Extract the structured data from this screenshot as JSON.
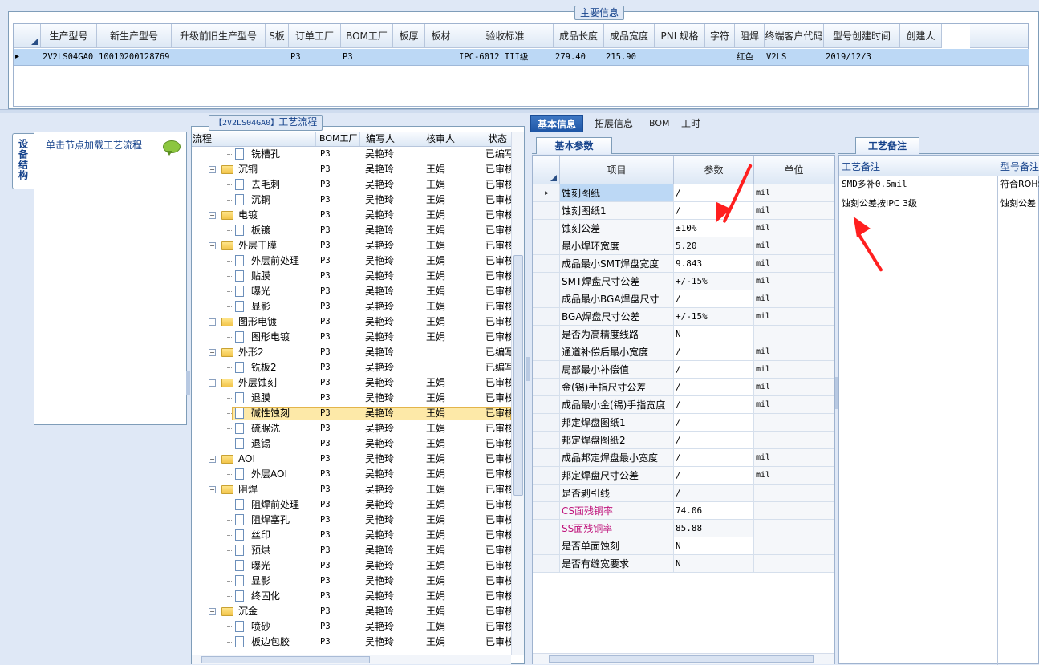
{
  "top_group": {
    "legend": "主要信息"
  },
  "main_grid": {
    "headers": [
      "生产型号",
      "新生产型号",
      "升级前旧生产型号",
      "S板",
      "订单工厂",
      "BOM工厂",
      "板厚",
      "板材",
      "验收标准",
      "成品长度",
      "成品宽度",
      "PNL规格",
      "字符",
      "阻焊",
      "终端客户代码",
      "型号创建时间",
      "创建人"
    ],
    "row": {
      "marker": "▸",
      "values": [
        "2V2LS04GA0",
        "10010200128769",
        "",
        "",
        "P3",
        "P3",
        "",
        "",
        "IPC-6012 III级",
        "279.40",
        "215.90",
        "",
        "",
        "红色",
        "V2LS",
        "2019/12/3",
        ""
      ]
    }
  },
  "left_panel": {
    "vertical_tab": "设备结构",
    "hint": "单击节点加载工艺流程"
  },
  "flow_panel": {
    "legend_prefix": "【2V2LS04GA0】",
    "legend_suffix": "工艺流程",
    "headers": [
      "流程",
      "BOM工厂",
      "编写人",
      "核审人",
      "状态"
    ],
    "rows": [
      {
        "type": "doc",
        "level": 2,
        "name": "铣槽孔",
        "bom": "P3",
        "writer": "吴艳玲",
        "reviewer": "",
        "status": "已编写"
      },
      {
        "type": "folder",
        "level": 1,
        "name": "沉铜",
        "bom": "P3",
        "writer": "吴艳玲",
        "reviewer": "王娟",
        "status": "已审核"
      },
      {
        "type": "doc",
        "level": 2,
        "name": "去毛刺",
        "bom": "P3",
        "writer": "吴艳玲",
        "reviewer": "王娟",
        "status": "已审核"
      },
      {
        "type": "doc",
        "level": 2,
        "name": "沉铜",
        "bom": "P3",
        "writer": "吴艳玲",
        "reviewer": "王娟",
        "status": "已审核"
      },
      {
        "type": "folder",
        "level": 1,
        "name": "电镀",
        "bom": "P3",
        "writer": "吴艳玲",
        "reviewer": "王娟",
        "status": "已审核"
      },
      {
        "type": "doc",
        "level": 2,
        "name": "板镀",
        "bom": "P3",
        "writer": "吴艳玲",
        "reviewer": "王娟",
        "status": "已审核"
      },
      {
        "type": "folder",
        "level": 1,
        "name": "外层干膜",
        "bom": "P3",
        "writer": "吴艳玲",
        "reviewer": "王娟",
        "status": "已审核"
      },
      {
        "type": "doc",
        "level": 2,
        "name": "外层前处理",
        "bom": "P3",
        "writer": "吴艳玲",
        "reviewer": "王娟",
        "status": "已审核"
      },
      {
        "type": "doc",
        "level": 2,
        "name": "贴膜",
        "bom": "P3",
        "writer": "吴艳玲",
        "reviewer": "王娟",
        "status": "已审核"
      },
      {
        "type": "doc",
        "level": 2,
        "name": "曝光",
        "bom": "P3",
        "writer": "吴艳玲",
        "reviewer": "王娟",
        "status": "已审核"
      },
      {
        "type": "doc",
        "level": 2,
        "name": "显影",
        "bom": "P3",
        "writer": "吴艳玲",
        "reviewer": "王娟",
        "status": "已审核"
      },
      {
        "type": "folder",
        "level": 1,
        "name": "图形电镀",
        "bom": "P3",
        "writer": "吴艳玲",
        "reviewer": "王娟",
        "status": "已审核"
      },
      {
        "type": "doc",
        "level": 2,
        "name": "图形电镀",
        "bom": "P3",
        "writer": "吴艳玲",
        "reviewer": "王娟",
        "status": "已审核"
      },
      {
        "type": "folder",
        "level": 1,
        "name": "外形2",
        "bom": "P3",
        "writer": "吴艳玲",
        "reviewer": "",
        "status": "已编写"
      },
      {
        "type": "doc",
        "level": 2,
        "name": "铣板2",
        "bom": "P3",
        "writer": "吴艳玲",
        "reviewer": "",
        "status": "已编写"
      },
      {
        "type": "folder",
        "level": 1,
        "name": "外层蚀刻",
        "bom": "P3",
        "writer": "吴艳玲",
        "reviewer": "王娟",
        "status": "已审核"
      },
      {
        "type": "doc",
        "level": 2,
        "name": "退膜",
        "bom": "P3",
        "writer": "吴艳玲",
        "reviewer": "王娟",
        "status": "已审核"
      },
      {
        "type": "doc",
        "level": 2,
        "name": "碱性蚀刻",
        "bom": "P3",
        "writer": "吴艳玲",
        "reviewer": "王娟",
        "status": "已审核",
        "selected": true
      },
      {
        "type": "doc",
        "level": 2,
        "name": "硫脲洗",
        "bom": "P3",
        "writer": "吴艳玲",
        "reviewer": "王娟",
        "status": "已审核"
      },
      {
        "type": "doc",
        "level": 2,
        "name": "退锡",
        "bom": "P3",
        "writer": "吴艳玲",
        "reviewer": "王娟",
        "status": "已审核"
      },
      {
        "type": "folder",
        "level": 1,
        "name": "AOI",
        "bom": "P3",
        "writer": "吴艳玲",
        "reviewer": "王娟",
        "status": "已审核"
      },
      {
        "type": "doc",
        "level": 2,
        "name": "外层AOI",
        "bom": "P3",
        "writer": "吴艳玲",
        "reviewer": "王娟",
        "status": "已审核"
      },
      {
        "type": "folder",
        "level": 1,
        "name": "阻焊",
        "bom": "P3",
        "writer": "吴艳玲",
        "reviewer": "王娟",
        "status": "已审核"
      },
      {
        "type": "doc",
        "level": 2,
        "name": "阻焊前处理",
        "bom": "P3",
        "writer": "吴艳玲",
        "reviewer": "王娟",
        "status": "已审核"
      },
      {
        "type": "doc",
        "level": 2,
        "name": "阻焊塞孔",
        "bom": "P3",
        "writer": "吴艳玲",
        "reviewer": "王娟",
        "status": "已审核"
      },
      {
        "type": "doc",
        "level": 2,
        "name": "丝印",
        "bom": "P3",
        "writer": "吴艳玲",
        "reviewer": "王娟",
        "status": "已审核"
      },
      {
        "type": "doc",
        "level": 2,
        "name": "预烘",
        "bom": "P3",
        "writer": "吴艳玲",
        "reviewer": "王娟",
        "status": "已审核"
      },
      {
        "type": "doc",
        "level": 2,
        "name": "曝光",
        "bom": "P3",
        "writer": "吴艳玲",
        "reviewer": "王娟",
        "status": "已审核"
      },
      {
        "type": "doc",
        "level": 2,
        "name": "显影",
        "bom": "P3",
        "writer": "吴艳玲",
        "reviewer": "王娟",
        "status": "已审核"
      },
      {
        "type": "doc",
        "level": 2,
        "name": "终固化",
        "bom": "P3",
        "writer": "吴艳玲",
        "reviewer": "王娟",
        "status": "已审核"
      },
      {
        "type": "folder",
        "level": 1,
        "name": "沉金",
        "bom": "P3",
        "writer": "吴艳玲",
        "reviewer": "王娟",
        "status": "已审核"
      },
      {
        "type": "doc",
        "level": 2,
        "name": "喷砂",
        "bom": "P3",
        "writer": "吴艳玲",
        "reviewer": "王娟",
        "status": "已审核"
      },
      {
        "type": "doc",
        "level": 2,
        "name": "板边包胶",
        "bom": "P3",
        "writer": "吴艳玲",
        "reviewer": "王娟",
        "status": "已审核"
      }
    ]
  },
  "detail_tabs": [
    "基本信息",
    "拓展信息",
    "BOM",
    "工时"
  ],
  "params_panel": {
    "tab": "基本参数",
    "headers": [
      "项目",
      "参数",
      "单位"
    ],
    "rows": [
      {
        "item": "蚀刻图纸",
        "value": "/",
        "unit": "mil",
        "white": true,
        "current": true
      },
      {
        "item": "蚀刻图纸1",
        "value": "/",
        "unit": "mil",
        "white": true
      },
      {
        "item": "蚀刻公差",
        "value": "±10%",
        "unit": "mil",
        "white": true
      },
      {
        "item": "最小焊环宽度",
        "value": "5.20",
        "unit": "mil",
        "white": false
      },
      {
        "item": "成品最小SMT焊盘宽度",
        "value": "9.843",
        "unit": "mil",
        "white": true
      },
      {
        "item": "SMT焊盘尺寸公差",
        "value": "+/-15%",
        "unit": "mil",
        "white": false
      },
      {
        "item": "成品最小BGA焊盘尺寸",
        "value": "/",
        "unit": "mil",
        "white": true
      },
      {
        "item": "BGA焊盘尺寸公差",
        "value": "+/-15%",
        "unit": "mil",
        "white": false
      },
      {
        "item": "是否为高精度线路",
        "value": "N",
        "unit": "",
        "white": true
      },
      {
        "item": "通道补偿后最小宽度",
        "value": "/",
        "unit": "mil",
        "white": true
      },
      {
        "item": "局部最小补偿值",
        "value": "/",
        "unit": "mil",
        "white": true
      },
      {
        "item": "金(锡)手指尺寸公差",
        "value": "/",
        "unit": "mil",
        "white": true
      },
      {
        "item": "成品最小金(锡)手指宽度",
        "value": "/",
        "unit": "mil",
        "white": true
      },
      {
        "item": "邦定焊盘图纸1",
        "value": "/",
        "unit": "",
        "white": true
      },
      {
        "item": "邦定焊盘图纸2",
        "value": "/",
        "unit": "",
        "white": true
      },
      {
        "item": "成品邦定焊盘最小宽度",
        "value": "/",
        "unit": "mil",
        "white": true
      },
      {
        "item": "邦定焊盘尺寸公差",
        "value": "/",
        "unit": "mil",
        "white": true
      },
      {
        "item": "是否剥引线",
        "value": "/",
        "unit": "",
        "white": false
      },
      {
        "item": "CS面残铜率",
        "value": "74.06",
        "unit": "",
        "white": true,
        "pink": true
      },
      {
        "item": "SS面残铜率",
        "value": "85.88",
        "unit": "",
        "white": false,
        "pink": true
      },
      {
        "item": "是否单面蚀刻",
        "value": "N",
        "unit": "",
        "white": true
      },
      {
        "item": "是否有缝宽要求",
        "value": "N",
        "unit": "",
        "white": false
      }
    ]
  },
  "notes_panel": {
    "tab": "工艺备注",
    "headers": [
      "工艺备注",
      "型号备注"
    ],
    "process_notes": [
      "SMD多补0.5mil",
      "蚀刻公差按IPC 3级"
    ],
    "model_notes": [
      "符合ROHS",
      "蚀刻公差"
    ]
  },
  "colors": {
    "accent": "#1e56a6",
    "selection": "#bcd8f5",
    "tree_selected": "#fde9a8",
    "pink_text": "#c0157c",
    "annotation": "#ff1f1f"
  }
}
